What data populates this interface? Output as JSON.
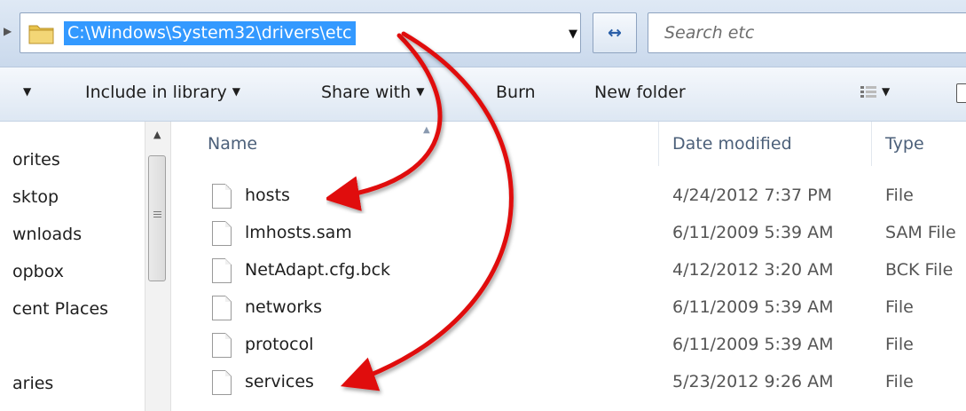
{
  "address_bar": {
    "path": "C:\\Windows\\System32\\drivers\\etc",
    "search_placeholder": "Search etc",
    "dropdown_glyph": "▼",
    "refresh_glyph": "↔"
  },
  "command_bar": {
    "organize_caret": "▼",
    "items": [
      {
        "label": "Include in library",
        "caret": "▼"
      },
      {
        "label": "Share with",
        "caret": "▼"
      },
      {
        "label": "Burn"
      },
      {
        "label": "New folder"
      }
    ],
    "views_caret": "▼"
  },
  "nav_pane": {
    "items": [
      "orites",
      "sktop",
      "wnloads",
      "opbox",
      "cent Places",
      "aries"
    ]
  },
  "file_list": {
    "columns": [
      "Name",
      "Date modified",
      "Type"
    ],
    "rows": [
      {
        "name": "hosts",
        "date": "4/24/2012 7:37 PM",
        "type": "File"
      },
      {
        "name": "lmhosts.sam",
        "date": "6/11/2009 5:39 AM",
        "type": "SAM File"
      },
      {
        "name": "NetAdapt.cfg.bck",
        "date": "4/12/2012 3:20 AM",
        "type": "BCK File"
      },
      {
        "name": "networks",
        "date": "6/11/2009 5:39 AM",
        "type": "File"
      },
      {
        "name": "protocol",
        "date": "6/11/2009 5:39 AM",
        "type": "File"
      },
      {
        "name": "services",
        "date": "5/23/2012 9:26 AM",
        "type": "File"
      }
    ]
  },
  "colors": {
    "address_highlight": "#3399ff",
    "annotation_arrow": "#e01010",
    "folder_yellow": "#e8c24a"
  },
  "icons": [
    "folder-icon",
    "refresh-icon",
    "views-icon",
    "preview-pane-icon",
    "file-icon",
    "scroll-up-icon"
  ]
}
